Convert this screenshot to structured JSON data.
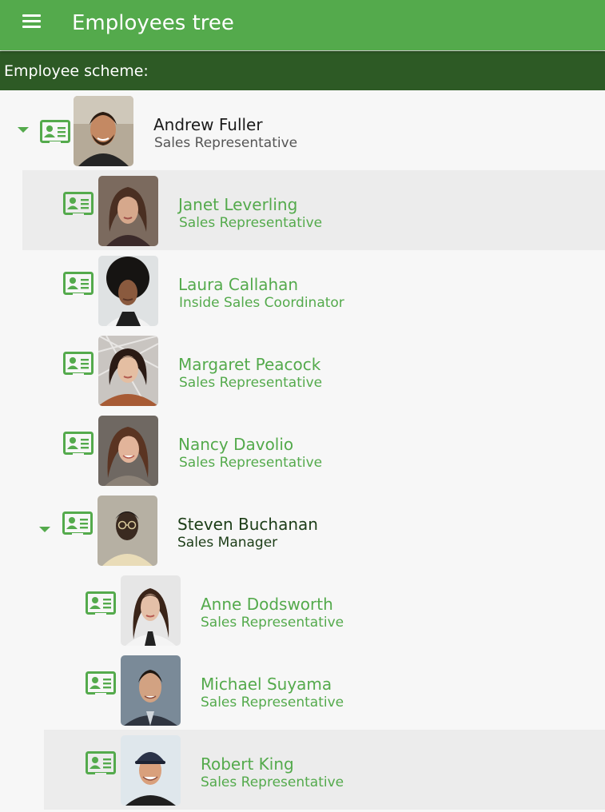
{
  "header": {
    "title": "Employees tree",
    "menu_icon": "hamburger-menu-icon"
  },
  "scheme": {
    "label": "Employee scheme:"
  },
  "colors": {
    "accent": "#54aa4c",
    "dark_bar": "#2d5a25",
    "highlight": "#ececec"
  },
  "employees": [
    {
      "name": "Andrew Fuller",
      "title": "Sales Representative",
      "expanded": true
    },
    {
      "name": "Janet Leverling",
      "title": "Sales Representative",
      "selected": true
    },
    {
      "name": "Laura Callahan",
      "title": "Inside Sales Coordinator"
    },
    {
      "name": "Margaret Peacock",
      "title": "Sales Representative"
    },
    {
      "name": "Nancy Davolio",
      "title": "Sales Representative"
    },
    {
      "name": "Steven Buchanan",
      "title": "Sales Manager",
      "expanded": true
    },
    {
      "name": "Anne Dodsworth",
      "title": "Sales Representative"
    },
    {
      "name": "Michael Suyama",
      "title": "Sales Representative"
    },
    {
      "name": "Robert King",
      "title": "Sales Representative",
      "selected": true
    }
  ]
}
